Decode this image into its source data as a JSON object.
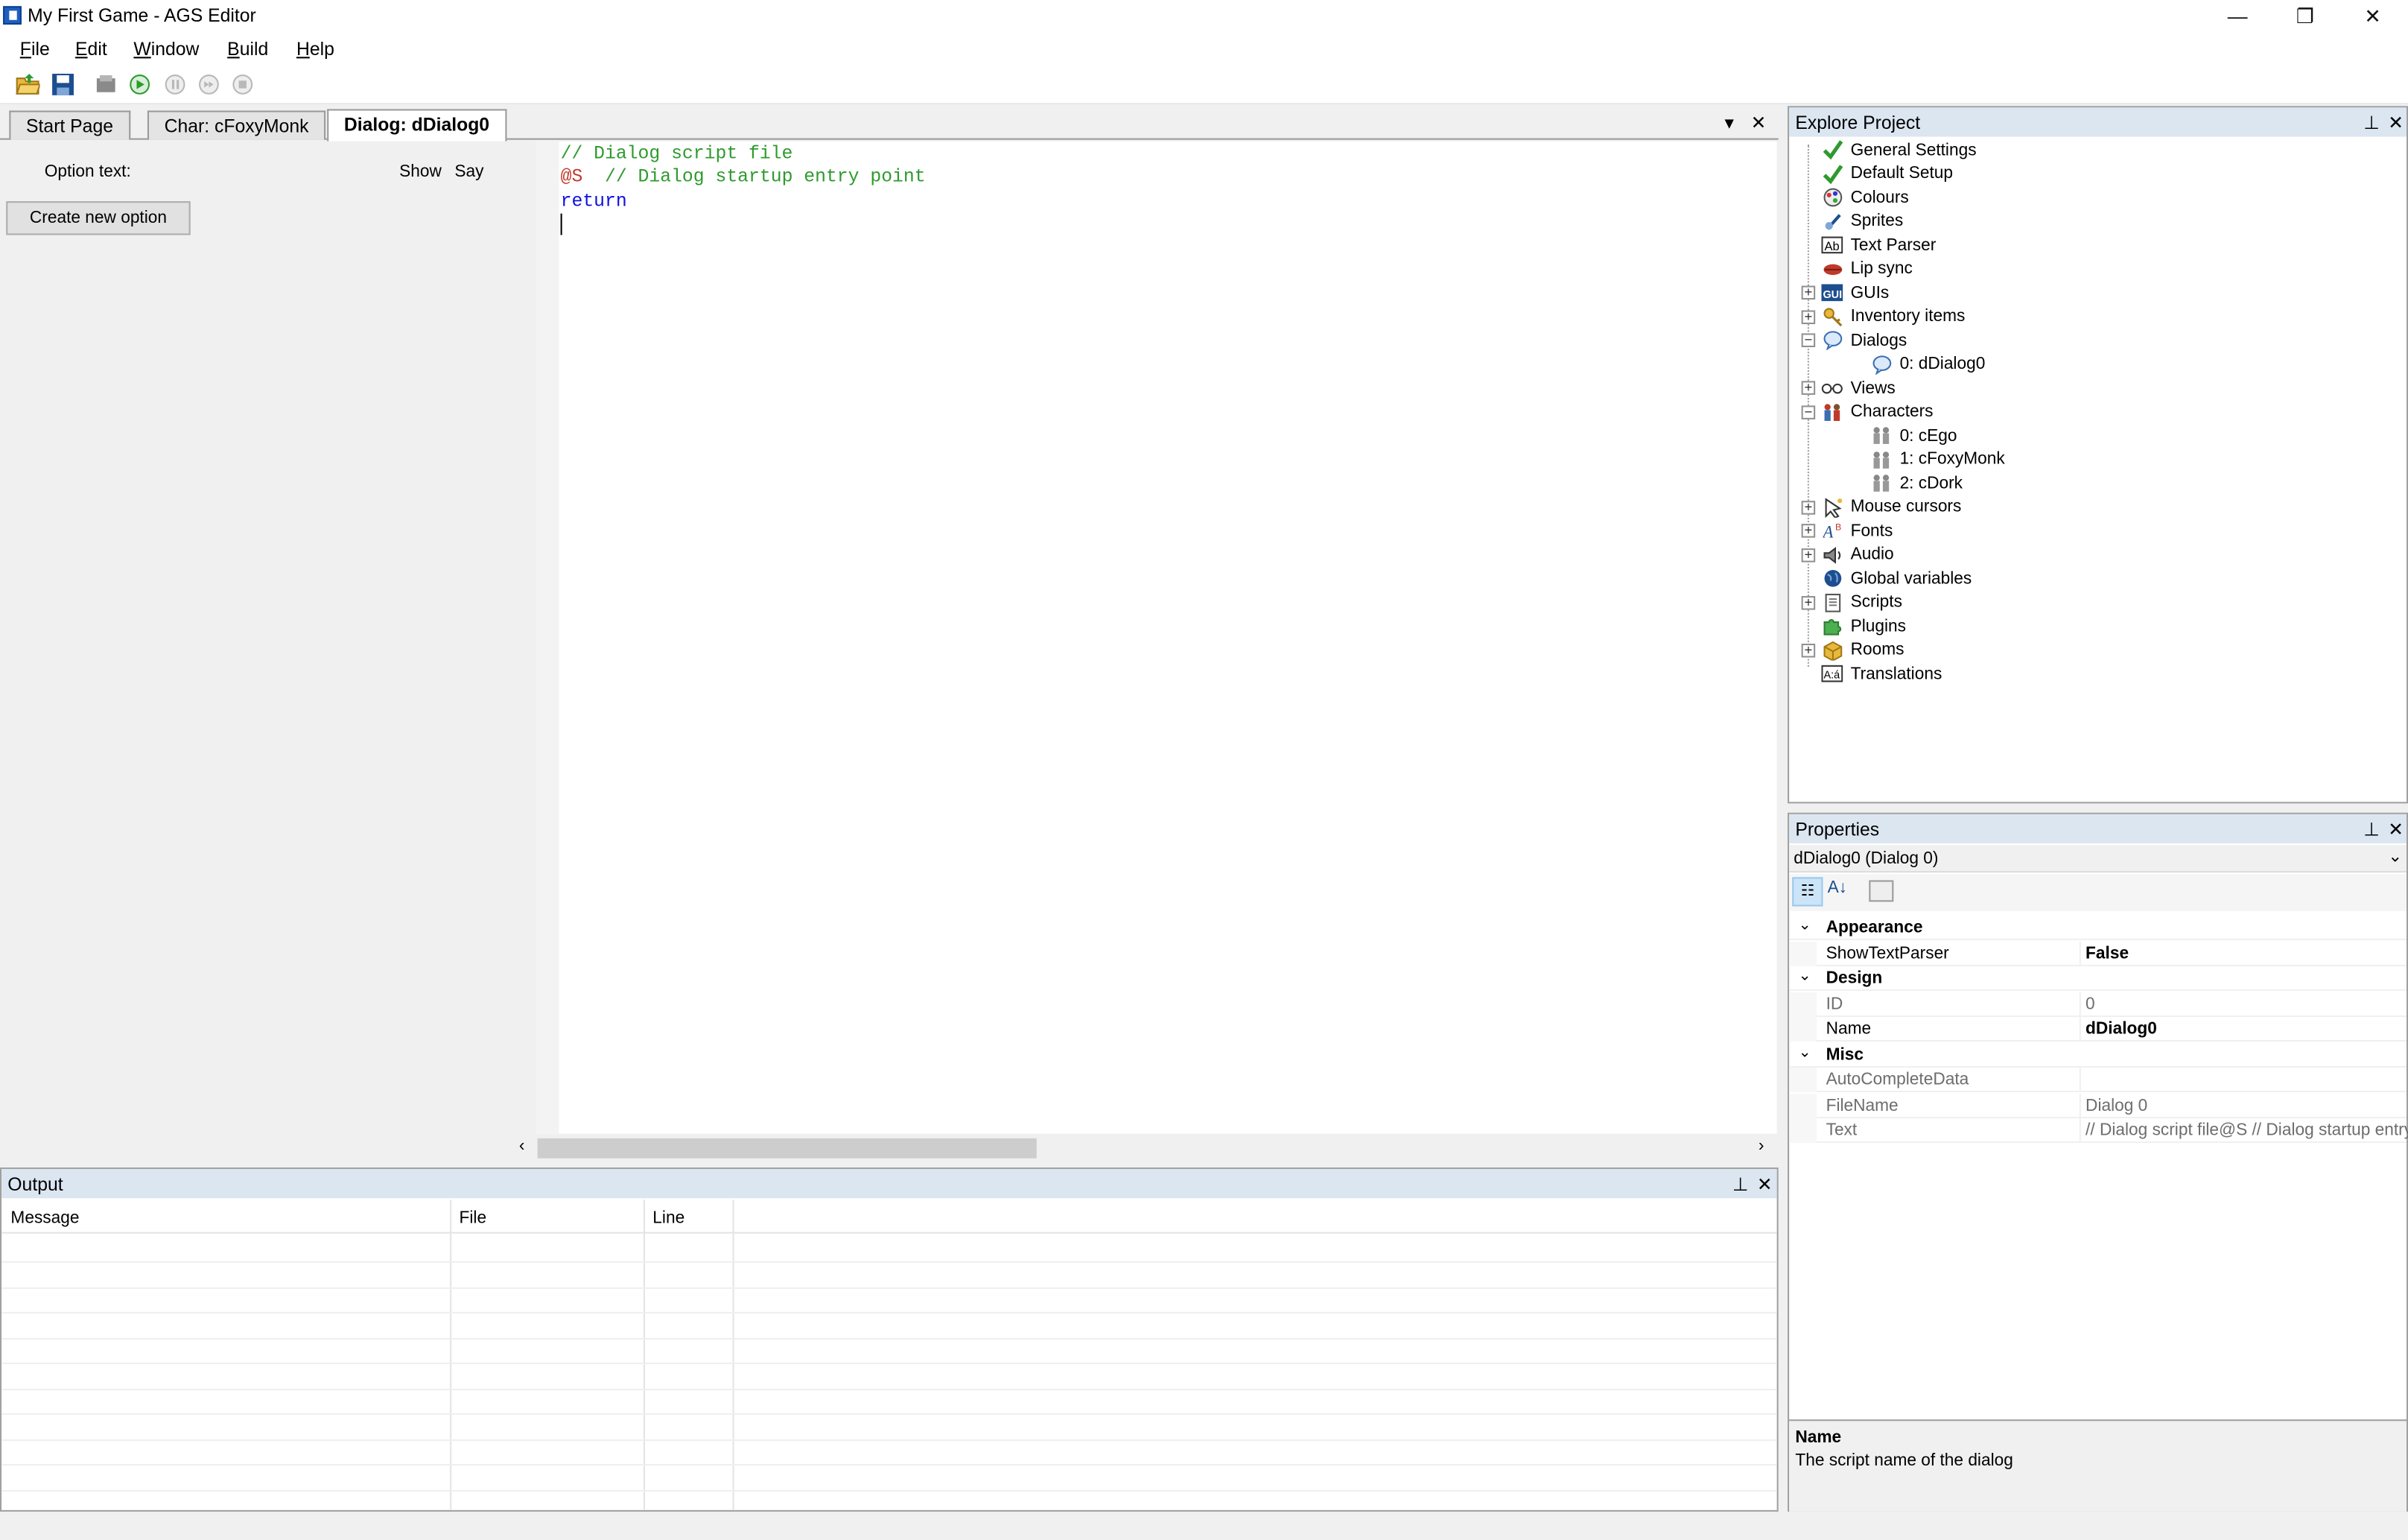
{
  "window": {
    "title": "My First Game - AGS Editor",
    "controls": {
      "minimize": "—",
      "restore": "❐",
      "close": "✕"
    }
  },
  "menu": [
    {
      "label": "File"
    },
    {
      "label": "Edit"
    },
    {
      "label": "Window"
    },
    {
      "label": "Build"
    },
    {
      "label": "Help"
    }
  ],
  "toolbar": {
    "icons": [
      "open-folder-icon",
      "save-icon",
      "build-icon",
      "run-icon",
      "pause-icon",
      "step-icon",
      "stop-icon"
    ]
  },
  "tabs": [
    {
      "label": "Start Page",
      "active": false
    },
    {
      "label": "Char: cFoxyMonk",
      "active": false
    },
    {
      "label": "Dialog: dDialog0",
      "active": true
    }
  ],
  "dialog_panel": {
    "option_text_label": "Option text:",
    "show_label": "Show",
    "say_label": "Say",
    "create_button": "Create new option"
  },
  "editor": {
    "lines": [
      {
        "text": "// Dialog script file",
        "color": "#2e9a2e"
      },
      {
        "text": "@S  // Dialog startup entry point",
        "color": "#2e9a2e",
        "prefix": "@S",
        "prefix_color": "#c0392b"
      },
      {
        "text": "return",
        "color": "#1010e0"
      }
    ]
  },
  "output": {
    "title": "Output",
    "columns": [
      "Message",
      "File",
      "Line"
    ]
  },
  "explorer": {
    "title": "Explore Project",
    "items": [
      {
        "label": "General Settings",
        "icon": "checkmark-icon",
        "level": 0,
        "expander": ""
      },
      {
        "label": "Default Setup",
        "icon": "checkmark-icon",
        "level": 0,
        "expander": ""
      },
      {
        "label": "Colours",
        "icon": "palette-icon",
        "level": 0,
        "expander": ""
      },
      {
        "label": "Sprites",
        "icon": "sprite-icon",
        "level": 0,
        "expander": ""
      },
      {
        "label": "Text Parser",
        "icon": "text-parser-icon",
        "level": 0,
        "expander": ""
      },
      {
        "label": "Lip sync",
        "icon": "lips-icon",
        "level": 0,
        "expander": ""
      },
      {
        "label": "GUIs",
        "icon": "gui-icon",
        "level": 0,
        "expander": "+"
      },
      {
        "label": "Inventory items",
        "icon": "key-icon",
        "level": 0,
        "expander": "+"
      },
      {
        "label": "Dialogs",
        "icon": "speech-bubble-icon",
        "level": 0,
        "expander": "-"
      },
      {
        "label": "0: dDialog0",
        "icon": "speech-bubble-icon",
        "level": 1,
        "expander": ""
      },
      {
        "label": "Views",
        "icon": "glasses-icon",
        "level": 0,
        "expander": "+"
      },
      {
        "label": "Characters",
        "icon": "characters-icon",
        "level": 0,
        "expander": "-"
      },
      {
        "label": "0: cEgo",
        "icon": "character-icon",
        "level": 1,
        "expander": ""
      },
      {
        "label": "1: cFoxyMonk",
        "icon": "character-icon",
        "level": 1,
        "expander": ""
      },
      {
        "label": "2: cDork",
        "icon": "character-icon",
        "level": 1,
        "expander": ""
      },
      {
        "label": "Mouse cursors",
        "icon": "cursor-icon",
        "level": 0,
        "expander": "+"
      },
      {
        "label": "Fonts",
        "icon": "font-icon",
        "level": 0,
        "expander": "+"
      },
      {
        "label": "Audio",
        "icon": "speaker-icon",
        "level": 0,
        "expander": "+"
      },
      {
        "label": "Global variables",
        "icon": "globe-icon",
        "level": 0,
        "expander": ""
      },
      {
        "label": "Scripts",
        "icon": "script-icon",
        "level": 0,
        "expander": "+"
      },
      {
        "label": "Plugins",
        "icon": "puzzle-icon",
        "level": 0,
        "expander": ""
      },
      {
        "label": "Rooms",
        "icon": "box-icon",
        "level": 0,
        "expander": "+"
      },
      {
        "label": "Translations",
        "icon": "translation-icon",
        "level": 0,
        "expander": ""
      }
    ]
  },
  "properties": {
    "title": "Properties",
    "selector": "dDialog0 (Dialog 0)",
    "rows": [
      {
        "type": "category",
        "name": "Appearance"
      },
      {
        "type": "prop",
        "name": "ShowTextParser",
        "value": "False",
        "bold": true,
        "dim": false
      },
      {
        "type": "category",
        "name": "Design"
      },
      {
        "type": "prop",
        "name": "ID",
        "value": "0",
        "bold": false,
        "dim": true
      },
      {
        "type": "prop",
        "name": "Name",
        "value": "dDialog0",
        "bold": true,
        "dim": false
      },
      {
        "type": "category",
        "name": "Misc"
      },
      {
        "type": "prop",
        "name": "AutoCompleteData",
        "value": "",
        "bold": false,
        "dim": true
      },
      {
        "type": "prop",
        "name": "FileName",
        "value": "Dialog 0",
        "bold": false,
        "dim": true
      },
      {
        "type": "prop",
        "name": "Text",
        "value": "// Dialog script file@S  // Dialog startup entry",
        "bold": false,
        "dim": true
      }
    ],
    "help_title": "Name",
    "help_text": "The script name of the dialog"
  }
}
